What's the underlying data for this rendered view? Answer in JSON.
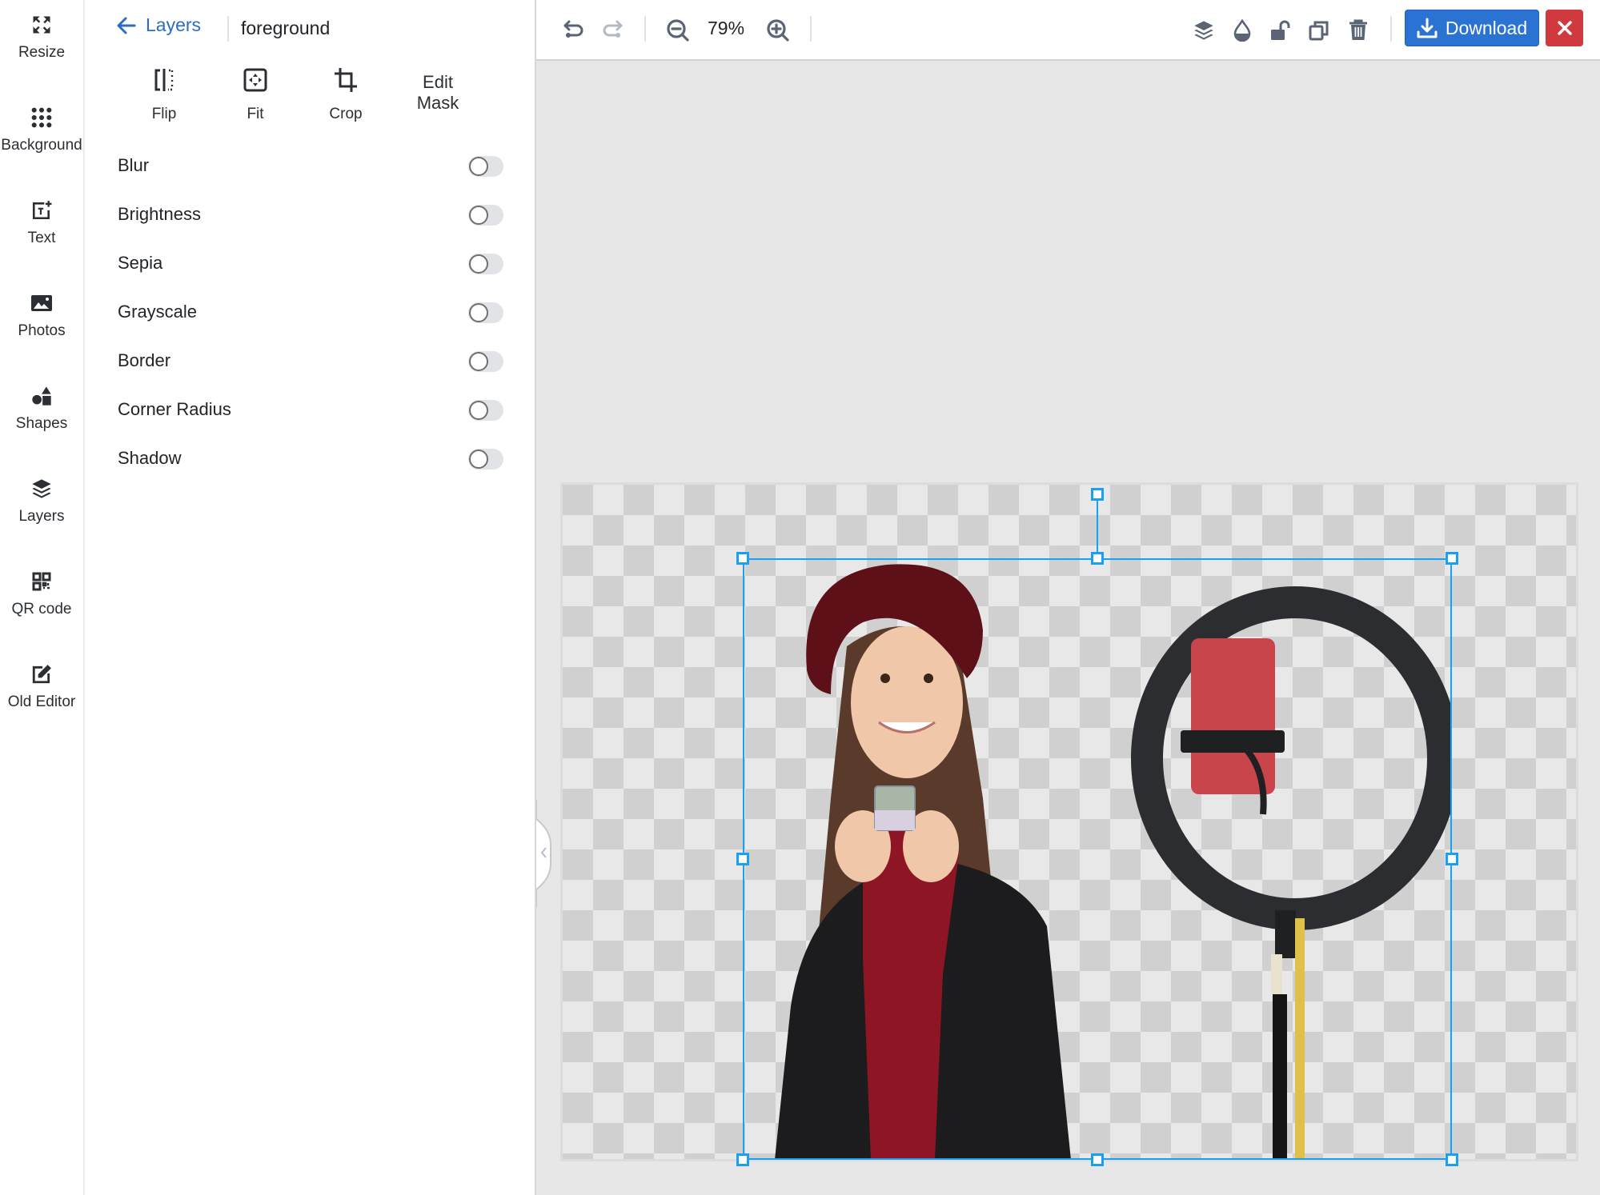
{
  "rail": {
    "items": [
      {
        "label": "Resize",
        "icon": "resize-icon"
      },
      {
        "label": "Background",
        "icon": "dots-grid-icon"
      },
      {
        "label": "Text",
        "icon": "text-add-icon"
      },
      {
        "label": "Photos",
        "icon": "image-icon"
      },
      {
        "label": "Shapes",
        "icon": "shapes-icon"
      },
      {
        "label": "Layers",
        "icon": "layers-icon"
      },
      {
        "label": "QR code",
        "icon": "qr-code-icon"
      },
      {
        "label": "Old Editor",
        "icon": "edit-icon"
      }
    ]
  },
  "panel": {
    "back_label": "Layers",
    "layer_name": "foreground",
    "tools": [
      {
        "label": "Flip",
        "icon": "flip-icon"
      },
      {
        "label": "Fit",
        "icon": "fit-icon"
      },
      {
        "label": "Crop",
        "icon": "crop-icon"
      },
      {
        "label": "Edit Mask",
        "line1": "Edit",
        "line2": "Mask"
      }
    ],
    "options": [
      {
        "label": "Blur",
        "enabled": false
      },
      {
        "label": "Brightness",
        "enabled": false
      },
      {
        "label": "Sepia",
        "enabled": false
      },
      {
        "label": "Grayscale",
        "enabled": false
      },
      {
        "label": "Border",
        "enabled": false
      },
      {
        "label": "Corner Radius",
        "enabled": false
      },
      {
        "label": "Shadow",
        "enabled": false
      }
    ]
  },
  "toolbar": {
    "zoom_value": "79%",
    "download_label": "Download",
    "icons": [
      "undo-icon",
      "redo-icon",
      "zoom-out-icon",
      "zoom-in-icon",
      "layers-icon",
      "opacity-icon",
      "unlock-icon",
      "duplicate-icon",
      "trash-icon",
      "download-icon",
      "close-icon"
    ]
  },
  "canvas": {
    "layer": "foreground",
    "content": "girl in red beret and black leather jacket holding a small cosmetic jar next to a ring light with red phone",
    "background": "transparent"
  },
  "colors": {
    "primary": "#2a73d3",
    "danger": "#d03a3f",
    "link": "#2b6cc4",
    "selection": "#1aa0f0",
    "workspace": "#e7e7e7"
  }
}
